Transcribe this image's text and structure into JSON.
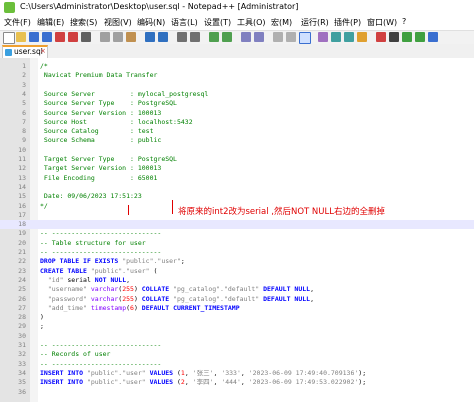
{
  "window": {
    "title": "C:\\Users\\Administrator\\Desktop\\user.sql - Notepad++ [Administrator]"
  },
  "menu": [
    "文件(F)",
    "编辑(E)",
    "搜索(S)",
    "视图(V)",
    "编码(N)",
    "语言(L)",
    "设置(T)",
    "工具(O)",
    "宏(M)",
    "运行(R)",
    "插件(P)",
    "窗口(W)",
    "?"
  ],
  "tab": {
    "label": "user.sql",
    "close": "×"
  },
  "annotation": "将原来的int2改为serial ,然后NOT NULL右边的全删掉",
  "lines": [
    {
      "n": "1",
      "parts": [
        {
          "c": "c-com",
          "t": "/*"
        }
      ]
    },
    {
      "n": "2",
      "parts": [
        {
          "c": "c-com",
          "t": " Navicat Premium Data Transfer"
        }
      ]
    },
    {
      "n": "3",
      "parts": [
        {
          "c": "c-com",
          "t": ""
        }
      ]
    },
    {
      "n": "4",
      "parts": [
        {
          "c": "c-com",
          "t": " Source Server         : mylocal_postgresql"
        }
      ]
    },
    {
      "n": "5",
      "parts": [
        {
          "c": "c-com",
          "t": " Source Server Type    : PostgreSQL"
        }
      ]
    },
    {
      "n": "6",
      "parts": [
        {
          "c": "c-com",
          "t": " Source Server Version : 100013"
        }
      ]
    },
    {
      "n": "7",
      "parts": [
        {
          "c": "c-com",
          "t": " Source Host           : localhost:5432"
        }
      ]
    },
    {
      "n": "8",
      "parts": [
        {
          "c": "c-com",
          "t": " Source Catalog        : test"
        }
      ]
    },
    {
      "n": "9",
      "parts": [
        {
          "c": "c-com",
          "t": " Source Schema         : public"
        }
      ]
    },
    {
      "n": "10",
      "parts": [
        {
          "c": "c-com",
          "t": ""
        }
      ]
    },
    {
      "n": "11",
      "parts": [
        {
          "c": "c-com",
          "t": " Target Server Type    : PostgreSQL"
        }
      ]
    },
    {
      "n": "12",
      "parts": [
        {
          "c": "c-com",
          "t": " Target Server Version : 100013"
        }
      ]
    },
    {
      "n": "13",
      "parts": [
        {
          "c": "c-com",
          "t": " File Encoding         : 65001"
        }
      ]
    },
    {
      "n": "14",
      "parts": [
        {
          "c": "c-com",
          "t": ""
        }
      ]
    },
    {
      "n": "15",
      "parts": [
        {
          "c": "c-com",
          "t": " Date: 09/06/2023 17:51:23"
        }
      ]
    },
    {
      "n": "16",
      "parts": [
        {
          "c": "c-com",
          "t": "*/"
        }
      ]
    },
    {
      "n": "17",
      "parts": []
    },
    {
      "n": "18",
      "current": true,
      "parts": []
    },
    {
      "n": "19",
      "parts": [
        {
          "c": "c-com",
          "t": "-- ----------------------------"
        }
      ]
    },
    {
      "n": "20",
      "parts": [
        {
          "c": "c-com",
          "t": "-- Table structure for user"
        }
      ]
    },
    {
      "n": "21",
      "parts": [
        {
          "c": "c-com",
          "t": "-- ----------------------------"
        }
      ]
    },
    {
      "n": "22",
      "parts": [
        {
          "c": "c-kw",
          "t": "DROP TABLE IF EXISTS "
        },
        {
          "c": "c-str",
          "t": "\"public\".\"user\""
        },
        {
          "c": "c-txt",
          "t": ";"
        }
      ]
    },
    {
      "n": "23",
      "parts": [
        {
          "c": "c-kw",
          "t": "CREATE TABLE "
        },
        {
          "c": "c-str",
          "t": "\"public\".\"user\""
        },
        {
          "c": "c-txt",
          "t": " ("
        }
      ]
    },
    {
      "n": "24",
      "parts": [
        {
          "c": "c-str",
          "t": "  \"id\""
        },
        {
          "c": "c-txt",
          "t": " serial "
        },
        {
          "c": "c-kw",
          "t": "NOT NULL"
        },
        {
          "c": "c-txt",
          "t": ","
        }
      ]
    },
    {
      "n": "25",
      "parts": [
        {
          "c": "c-str",
          "t": "  \"username\""
        },
        {
          "c": "c-type",
          "t": " varchar"
        },
        {
          "c": "c-txt",
          "t": "("
        },
        {
          "c": "c-num",
          "t": "255"
        },
        {
          "c": "c-txt",
          "t": ") "
        },
        {
          "c": "c-kw",
          "t": "COLLATE "
        },
        {
          "c": "c-str",
          "t": "\"pg_catalog\".\"default\""
        },
        {
          "c": "c-kw",
          "t": " DEFAULT NULL"
        },
        {
          "c": "c-txt",
          "t": ","
        }
      ]
    },
    {
      "n": "26",
      "parts": [
        {
          "c": "c-str",
          "t": "  \"password\""
        },
        {
          "c": "c-type",
          "t": " varchar"
        },
        {
          "c": "c-txt",
          "t": "("
        },
        {
          "c": "c-num",
          "t": "255"
        },
        {
          "c": "c-txt",
          "t": ") "
        },
        {
          "c": "c-kw",
          "t": "COLLATE "
        },
        {
          "c": "c-str",
          "t": "\"pg_catalog\".\"default\""
        },
        {
          "c": "c-kw",
          "t": " DEFAULT NULL"
        },
        {
          "c": "c-txt",
          "t": ","
        }
      ]
    },
    {
      "n": "27",
      "parts": [
        {
          "c": "c-str",
          "t": "  \"add_time\""
        },
        {
          "c": "c-type",
          "t": " timestamp"
        },
        {
          "c": "c-txt",
          "t": "("
        },
        {
          "c": "c-num",
          "t": "6"
        },
        {
          "c": "c-txt",
          "t": ") "
        },
        {
          "c": "c-kw",
          "t": "DEFAULT CURRENT_TIMESTAMP"
        }
      ]
    },
    {
      "n": "28",
      "parts": [
        {
          "c": "c-txt",
          "t": ")"
        }
      ]
    },
    {
      "n": "29",
      "parts": [
        {
          "c": "c-txt",
          "t": ";"
        }
      ]
    },
    {
      "n": "30",
      "parts": []
    },
    {
      "n": "31",
      "parts": [
        {
          "c": "c-com",
          "t": "-- ----------------------------"
        }
      ]
    },
    {
      "n": "32",
      "parts": [
        {
          "c": "c-com",
          "t": "-- Records of user"
        }
      ]
    },
    {
      "n": "33",
      "parts": [
        {
          "c": "c-com",
          "t": "-- ----------------------------"
        }
      ]
    },
    {
      "n": "34",
      "parts": [
        {
          "c": "c-kw",
          "t": "INSERT INTO "
        },
        {
          "c": "c-str",
          "t": "\"public\".\"user\""
        },
        {
          "c": "c-kw",
          "t": " VALUES "
        },
        {
          "c": "c-txt",
          "t": "("
        },
        {
          "c": "c-num",
          "t": "1"
        },
        {
          "c": "c-txt",
          "t": ", "
        },
        {
          "c": "c-str",
          "t": "'张三'"
        },
        {
          "c": "c-txt",
          "t": ", "
        },
        {
          "c": "c-str",
          "t": "'333'"
        },
        {
          "c": "c-txt",
          "t": ", "
        },
        {
          "c": "c-str",
          "t": "'2023-06-09 17:49:40.709136'"
        },
        {
          "c": "c-txt",
          "t": ");"
        }
      ]
    },
    {
      "n": "35",
      "parts": [
        {
          "c": "c-kw",
          "t": "INSERT INTO "
        },
        {
          "c": "c-str",
          "t": "\"public\".\"user\""
        },
        {
          "c": "c-kw",
          "t": " VALUES "
        },
        {
          "c": "c-txt",
          "t": "("
        },
        {
          "c": "c-num",
          "t": "2"
        },
        {
          "c": "c-txt",
          "t": ", "
        },
        {
          "c": "c-str",
          "t": "'李四'"
        },
        {
          "c": "c-txt",
          "t": ", "
        },
        {
          "c": "c-str",
          "t": "'444'"
        },
        {
          "c": "c-txt",
          "t": ", "
        },
        {
          "c": "c-str",
          "t": "'2023-06-09 17:49:53.022902'"
        },
        {
          "c": "c-txt",
          "t": ");"
        }
      ]
    },
    {
      "n": "36",
      "parts": []
    }
  ]
}
